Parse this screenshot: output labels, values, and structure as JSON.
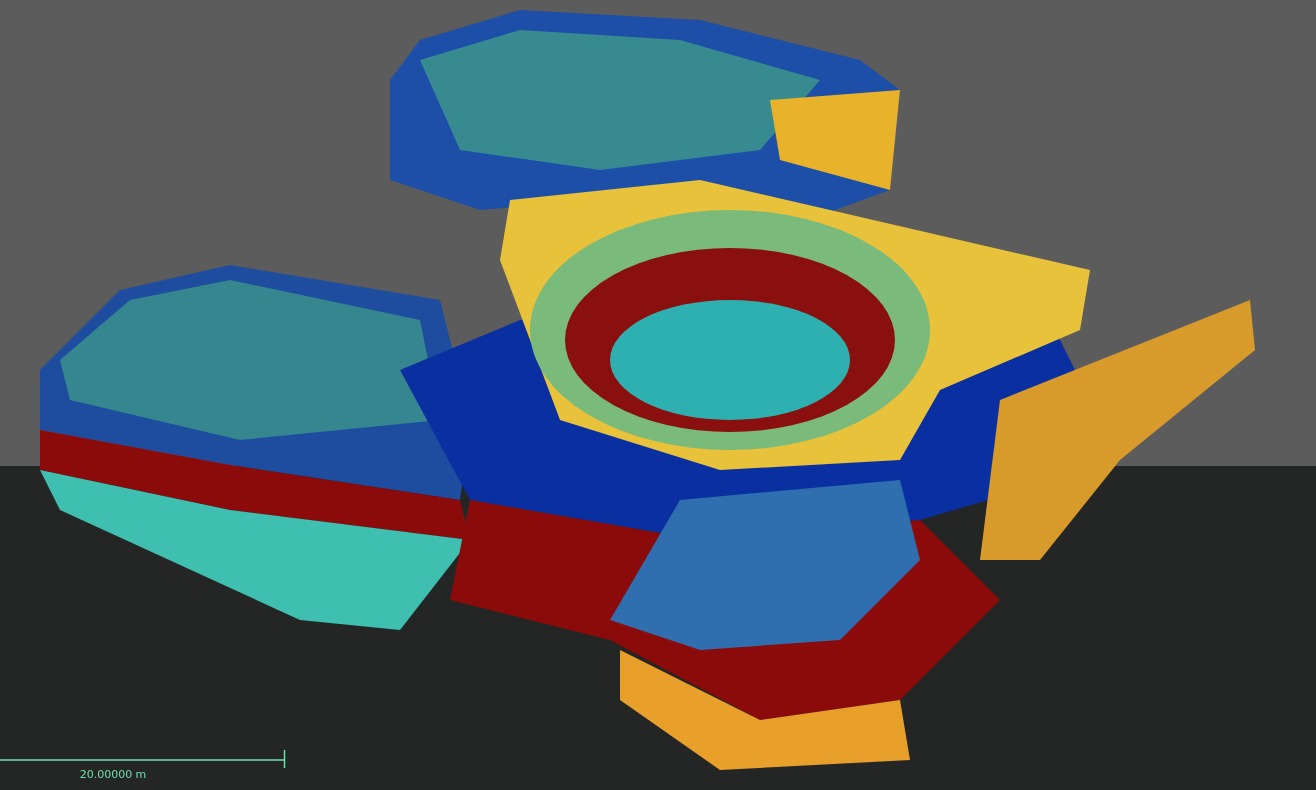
{
  "scale_bar": {
    "label": "20.00000 m"
  }
}
